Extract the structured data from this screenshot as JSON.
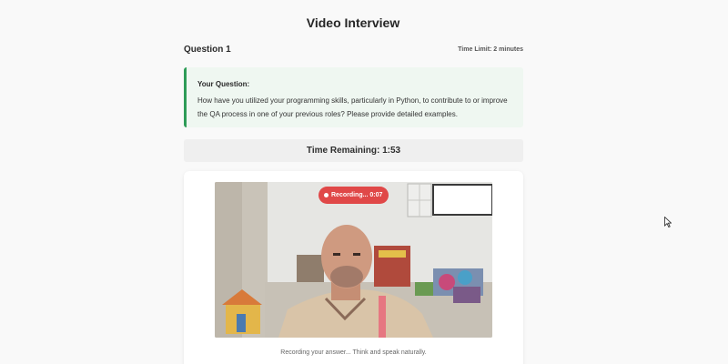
{
  "page": {
    "title": "Video Interview"
  },
  "question": {
    "number_label": "Question 1",
    "time_limit": "Time Limit: 2 minutes",
    "label": "Your Question:",
    "text": "How have you utilized your programming skills, particularly in Python, to contribute to or improve the QA process in one of your previous roles? Please provide detailed examples."
  },
  "timer": {
    "text": "Time Remaining: 1:53"
  },
  "recording": {
    "badge": "Recording... 0:07",
    "caption": "Recording your answer... Think and speak naturally."
  },
  "colors": {
    "accent_green": "#2e9c57",
    "question_bg": "#eff7f1",
    "recording_red": "#e04848"
  },
  "icons": {
    "recording_indicator": "record-dot-icon",
    "cursor": "mouse-pointer-icon"
  }
}
